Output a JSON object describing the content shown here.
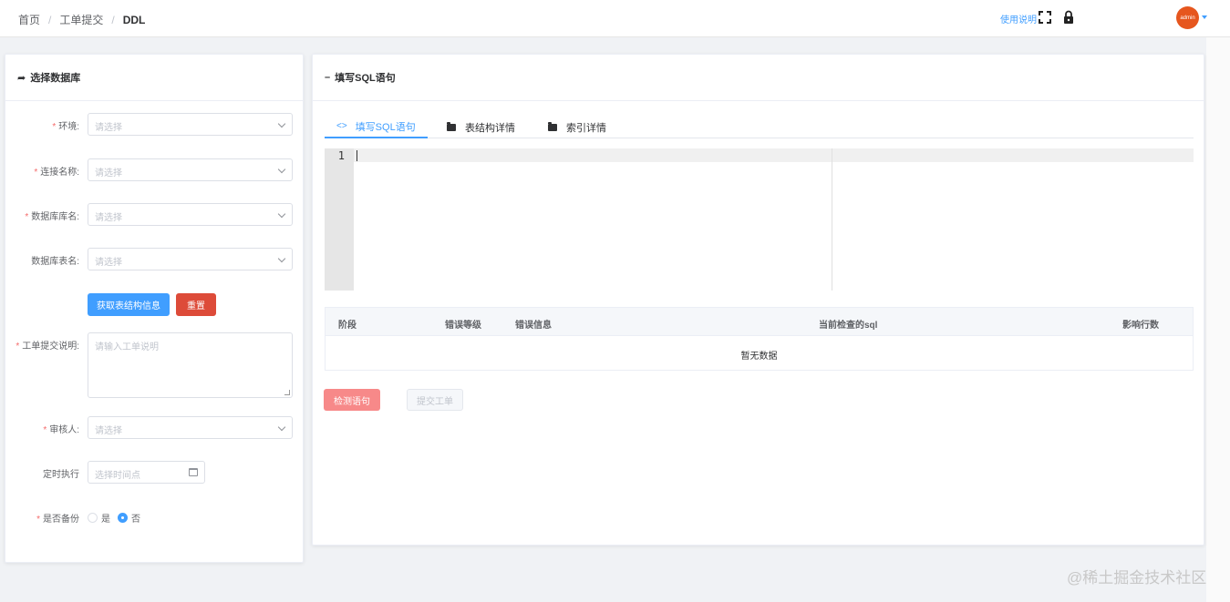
{
  "breadcrumb": {
    "home": "首页",
    "section": "工单提交",
    "current": "DDL",
    "separator": "/"
  },
  "header": {
    "help_label": "使用说明",
    "user_label": "admin"
  },
  "left_card": {
    "title": "选择数据库",
    "fields": {
      "env": {
        "label": "环境:",
        "placeholder": "请选择"
      },
      "connection": {
        "label": "连接名称:",
        "placeholder": "请选择"
      },
      "db_name": {
        "label": "数据库库名:",
        "placeholder": "请选择"
      },
      "table_name": {
        "label": "数据库表名:",
        "placeholder": "请选择"
      },
      "description": {
        "label": "工单提交说明:",
        "placeholder": "请输入工单说明"
      },
      "reviewer": {
        "label": "审核人:",
        "placeholder": "请选择"
      },
      "schedule": {
        "label": "定时执行",
        "placeholder": "选择时间点"
      },
      "backup": {
        "label": "是否备份",
        "option_yes": "是",
        "option_no": "否",
        "selected": "否"
      }
    },
    "buttons": {
      "fetch": "获取表结构信息",
      "reset": "重置"
    }
  },
  "right_card": {
    "title": "填写SQL语句",
    "tabs": [
      {
        "label": "填写SQL语句",
        "active": true
      },
      {
        "label": "表结构详情",
        "active": false
      },
      {
        "label": "索引详情",
        "active": false
      }
    ],
    "editor": {
      "line_number": "1"
    },
    "table": {
      "columns": [
        "阶段",
        "错误等级",
        "错误信息",
        "当前检查的sql",
        "影响行数"
      ],
      "empty_text": "暂无数据"
    },
    "buttons": {
      "check": "检测语句",
      "submit": "提交工单"
    }
  },
  "watermark": "@稀土掘金技术社区",
  "colors": {
    "primary": "#409eff",
    "danger": "#dd4b39",
    "avatar": "#e6561e"
  }
}
